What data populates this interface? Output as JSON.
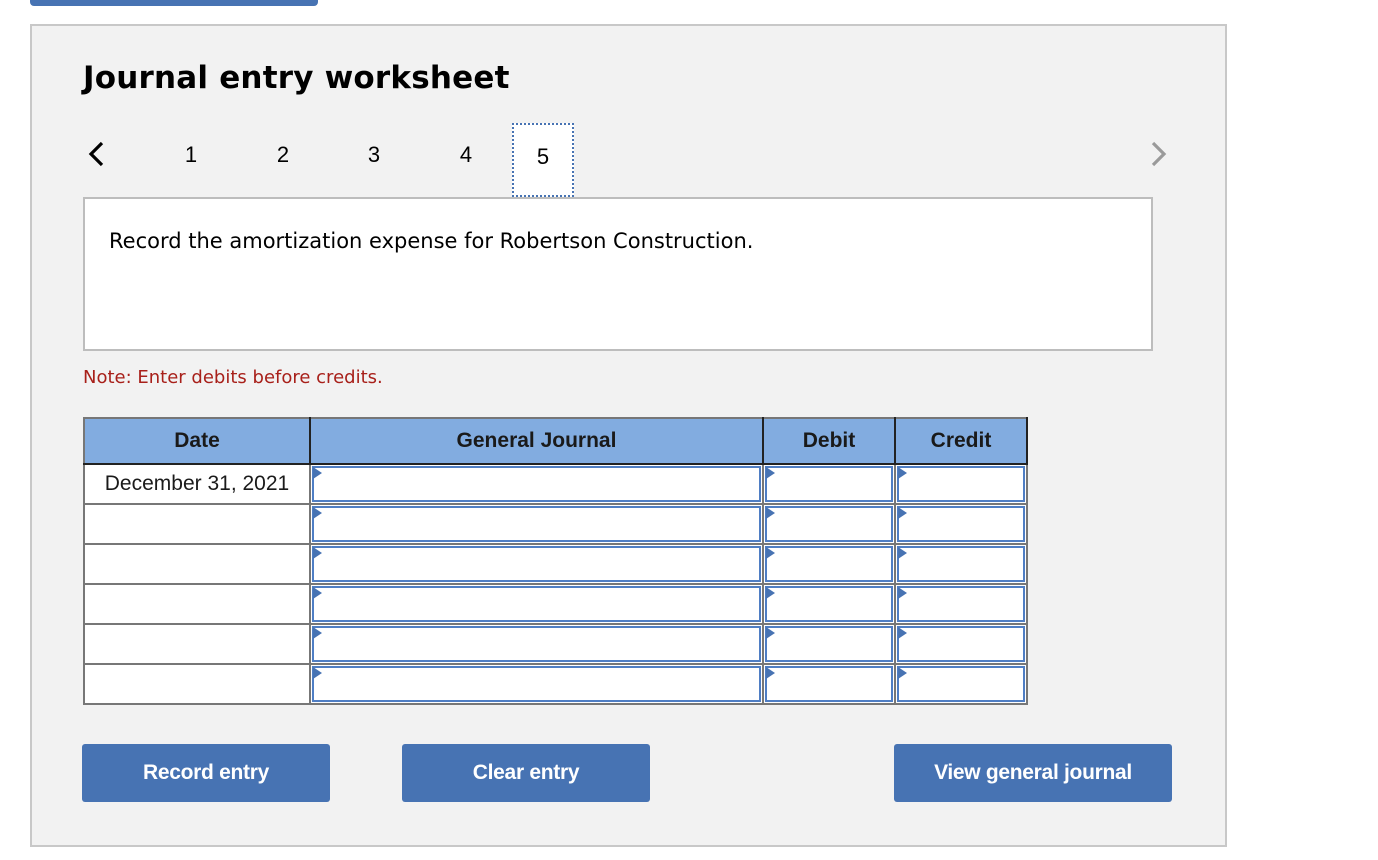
{
  "worksheet": {
    "title": "Journal entry worksheet",
    "steps": [
      "1",
      "2",
      "3",
      "4",
      "5"
    ],
    "active_step": "5",
    "prev_icon": "chevron-left-icon",
    "next_icon": "chevron-right-icon",
    "question": "Record the amortization expense for Robertson Construction.",
    "note": "Note: Enter debits before credits."
  },
  "table": {
    "headers": [
      "Date",
      "General Journal",
      "Debit",
      "Credit"
    ],
    "rows": [
      {
        "date": "December 31, 2021",
        "account": "",
        "debit": "",
        "credit": ""
      },
      {
        "date": "",
        "account": "",
        "debit": "",
        "credit": ""
      },
      {
        "date": "",
        "account": "",
        "debit": "",
        "credit": ""
      },
      {
        "date": "",
        "account": "",
        "debit": "",
        "credit": ""
      },
      {
        "date": "",
        "account": "",
        "debit": "",
        "credit": ""
      },
      {
        "date": "",
        "account": "",
        "debit": "",
        "credit": ""
      }
    ]
  },
  "buttons": {
    "record": "Record entry",
    "clear": "Clear entry",
    "view": "View general journal"
  },
  "colors": {
    "accent": "#4773b3",
    "header_bg": "#82ace0",
    "note": "#a8201a",
    "panel_bg": "#f2f2f2"
  }
}
